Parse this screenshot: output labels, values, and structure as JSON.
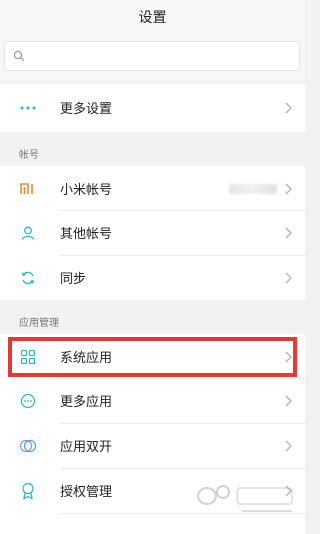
{
  "header": {
    "title": "设置"
  },
  "search": {
    "placeholder": ""
  },
  "rows_top": [
    {
      "label": "更多设置",
      "icon": "more-dots-icon"
    }
  ],
  "accounts": {
    "header": "帐号",
    "items": [
      {
        "label": "小米帐号",
        "icon": "mi-icon",
        "value_blurred": true
      },
      {
        "label": "其他帐号",
        "icon": "person-icon"
      },
      {
        "label": "同步",
        "icon": "sync-icon"
      }
    ]
  },
  "apps": {
    "header": "应用管理",
    "items": [
      {
        "label": "系统应用",
        "icon": "grid-apps-icon",
        "highlighted": true
      },
      {
        "label": "更多应用",
        "icon": "more-apps-icon"
      },
      {
        "label": "应用双开",
        "icon": "dual-apps-icon"
      },
      {
        "label": "授权管理",
        "icon": "authorization-icon"
      }
    ]
  },
  "colors": {
    "accent_teal": "#2bb6c8",
    "mi_orange": "#f08a24",
    "highlight_red": "#e53935"
  }
}
